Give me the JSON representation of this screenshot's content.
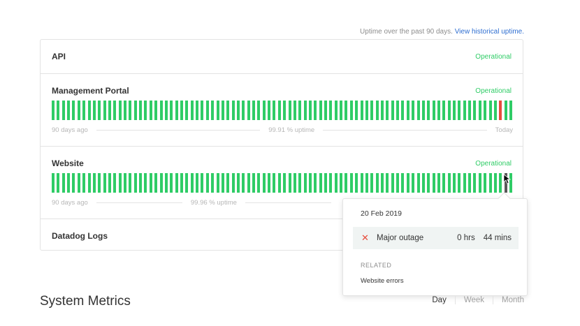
{
  "uptime_note": {
    "text": "Uptime over the past 90 days.",
    "link": "View historical uptime."
  },
  "components": [
    {
      "name": "API",
      "status": "Operational"
    },
    {
      "name": "Management Portal",
      "status": "Operational",
      "legend_start": "90 days ago",
      "legend_uptime": "99.91 % uptime",
      "legend_end": "Today"
    },
    {
      "name": "Website",
      "status": "Operational",
      "legend_start": "90 days ago",
      "legend_uptime": "99.96 % uptime"
    },
    {
      "name": "Datadog Logs"
    }
  ],
  "tooltip": {
    "date": "20 Feb 2019",
    "incident_type": "Major outage",
    "hours": "0 hrs",
    "minutes": "44 mins",
    "related_label": "RELATED",
    "related_link": "Website errors"
  },
  "metrics": {
    "title": "System Metrics",
    "ranges": [
      "Day",
      "Week",
      "Month"
    ],
    "active_range": "Day"
  },
  "colors": {
    "operational": "#2fcc66",
    "outage": "#e74c3c",
    "link": "#2f6fd1"
  }
}
